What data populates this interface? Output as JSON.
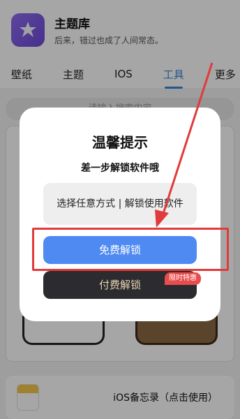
{
  "app": {
    "title": "主题库",
    "subtitle": "后来，错过也成了人间常态。"
  },
  "tabs": [
    {
      "label": "壁纸",
      "active": false
    },
    {
      "label": "主题",
      "active": false
    },
    {
      "label": "IOS",
      "active": false
    },
    {
      "label": "工具",
      "active": true
    },
    {
      "label": "更多",
      "active": false
    }
  ],
  "search": {
    "placeholder": "请输入搜索内容"
  },
  "note_card": {
    "label": "iOS备忘录（点击使用）"
  },
  "dialog": {
    "title": "温馨提示",
    "subtitle": "差一步解锁软件哦",
    "choose_text": "选择任意方式 | 解锁使用软件",
    "free_button": "免费解锁",
    "paid_button": "付费解锁",
    "badge": "限时特惠"
  },
  "colors": {
    "accent": "#3a86d8",
    "free_button": "#4f89f2",
    "highlight": "#e23a3a",
    "badge": "#e94c4c"
  }
}
